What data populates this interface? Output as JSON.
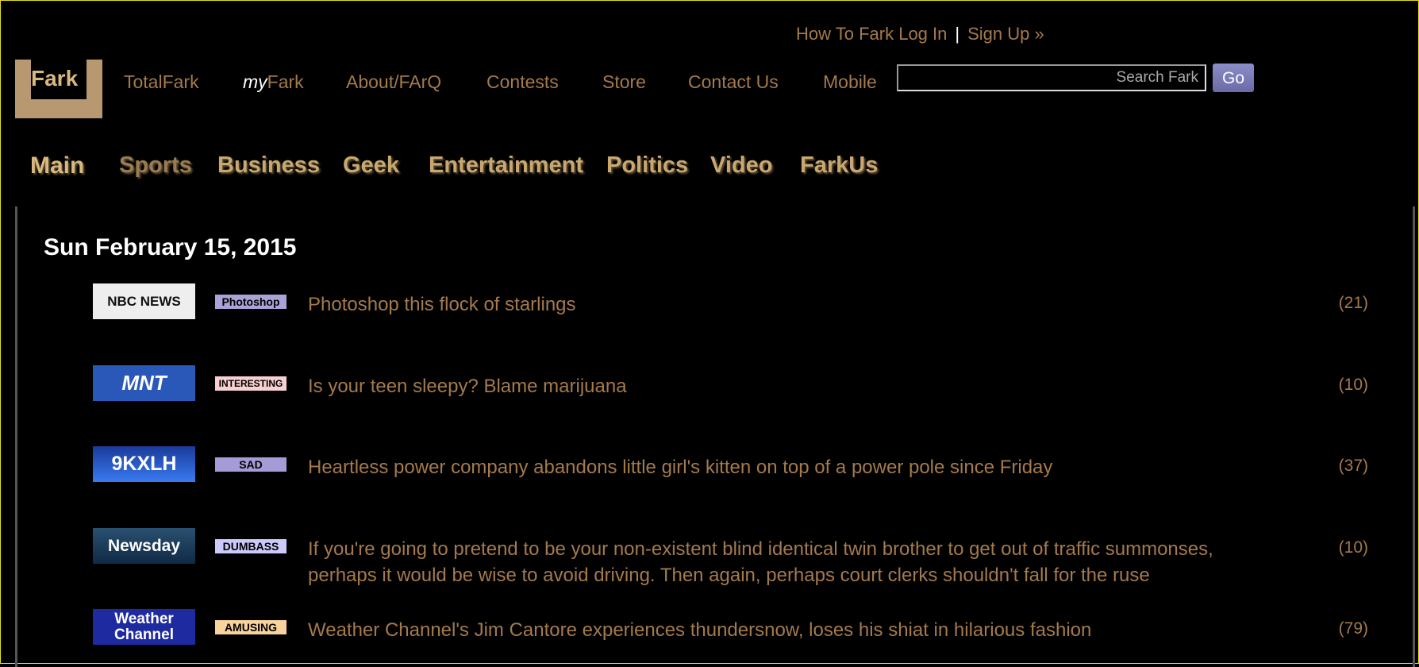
{
  "top_links": {
    "how_to": "How To Fark",
    "log_in": "Log In",
    "separator": "|",
    "sign_up": "Sign Up »"
  },
  "logo": {
    "text": "Fark"
  },
  "nav": {
    "totalfark": "TotalFark",
    "my_prefix": "my",
    "my_suffix": "Fark",
    "about": "About/FArQ",
    "contests": "Contests",
    "store": "Store",
    "contact": "Contact Us",
    "mobile": "Mobile"
  },
  "search": {
    "placeholder": "Search Fark",
    "value": "",
    "go": "Go"
  },
  "categories": [
    "Main",
    "Sports",
    "Business",
    "Geek",
    "Entertainment",
    "Politics",
    "Video",
    "FarkUs"
  ],
  "date": "Sun February 15, 2015",
  "items": [
    {
      "source": "NBC NEWS",
      "tag": "Photoshop",
      "tag_color": "#a9a3d8",
      "headline": "Photoshop this flock of starlings",
      "count": "(21)"
    },
    {
      "source": "MNT",
      "tag": "INTERESTING",
      "tag_color": "#f8d0d0",
      "headline": "Is your teen sleepy? Blame marijuana",
      "count": "(10)"
    },
    {
      "source": "9KXLH",
      "tag": "SAD",
      "tag_color": "#a59bd6",
      "headline": "Heartless power company abandons little girl's kitten on top of a power pole since Friday",
      "count": "(37)"
    },
    {
      "source": "Newsday",
      "tag": "DUMBASS",
      "tag_color": "#cccafa",
      "headline": "If you're going to pretend to be your non-existent blind identical twin brother to get out of traffic summonses, perhaps it would be wise to avoid driving. Then again, perhaps court clerks shouldn't fall for the ruse",
      "count": "(10)"
    },
    {
      "source": "Weather Channel",
      "tag": "AMUSING",
      "tag_color": "#f8d49c",
      "headline": "Weather Channel's Jim Cantore experiences thundersnow, loses his shiat in hilarious fashion",
      "count": "(79)"
    }
  ]
}
